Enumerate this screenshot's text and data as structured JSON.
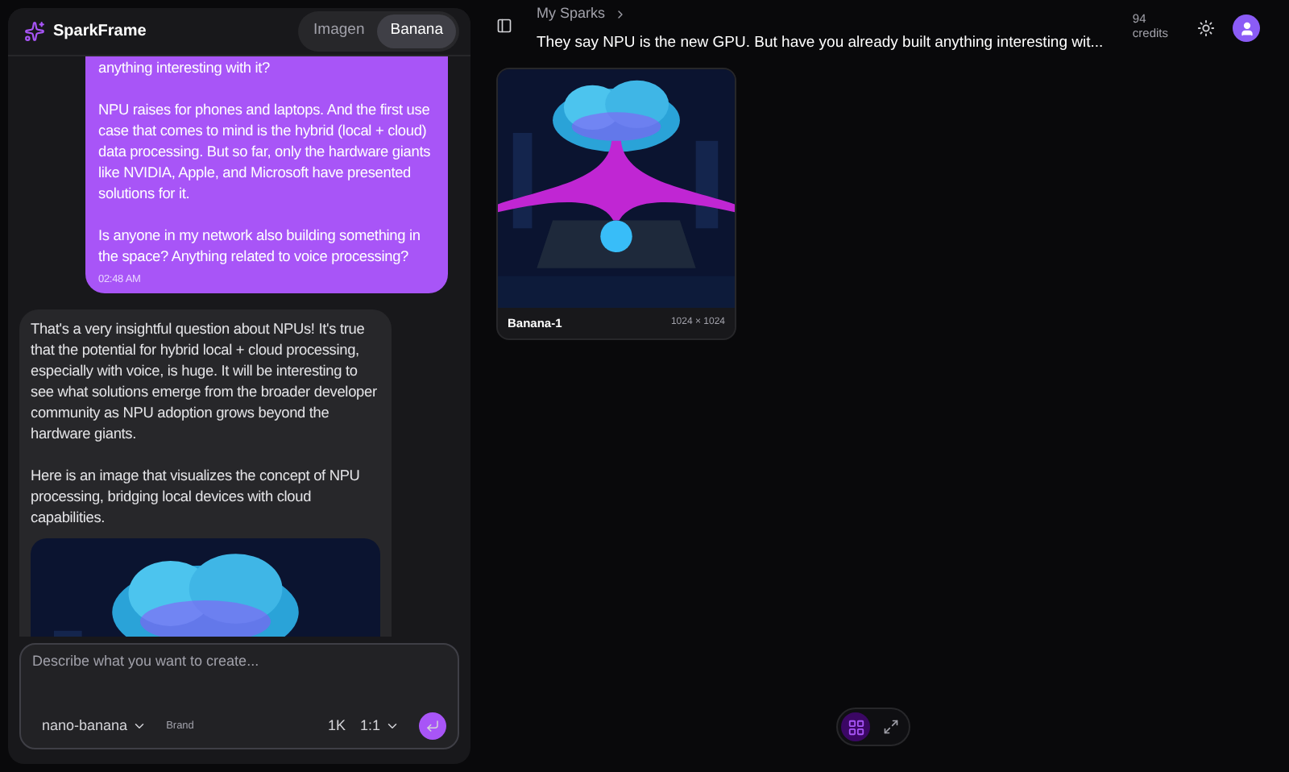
{
  "sidebar": {
    "brand": "SparkFrame",
    "model_tabs": [
      {
        "label": "Imagen",
        "selected": false
      },
      {
        "label": "Banana",
        "selected": true
      }
    ],
    "messages": [
      {
        "kind": "user",
        "paragraphs": [
          "anything interesting with it?",
          "NPU raises for phones and laptops. And the first use case that comes to mind is the hybrid (local + cloud) data processing. But so far, only the hardware giants like NVIDIA, Apple, and Microsoft have presented solutions for it.",
          "Is anyone in my network also building something in the space? Anything related to voice processing?"
        ],
        "time": "02:48 AM"
      },
      {
        "kind": "assistant",
        "paragraphs": [
          "That's a very insightful question about NPUs! It's true that the potential for hybrid local + cloud processing, especially with voice, is huge. It will be interesting to see what solutions emerge from the broader developer community as NPU adoption grows beyond the hardware giants.",
          "Here is an image that visualizes the concept of NPU processing, bridging local devices with cloud capabilities."
        ],
        "image": {
          "kind": "picture"
        }
      }
    ],
    "composer": {
      "placeholder": "Describe what you want to create...",
      "model": "nano-banana",
      "tag": "Brand",
      "resolution": "1K",
      "aspect": "1:1"
    }
  },
  "topbar": {
    "breadcrumb": "My Sparks",
    "title": "They say NPU is the new GPU. But have you already built anything interesting wit...",
    "credits_value": "94",
    "credits_label": "credits"
  },
  "gallery": [
    {
      "name": "Banana-1",
      "size": "1024 × 1024"
    }
  ],
  "view_toggle": [
    {
      "kind": "grid",
      "selected": true
    },
    {
      "kind": "expand",
      "selected": false
    }
  ]
}
